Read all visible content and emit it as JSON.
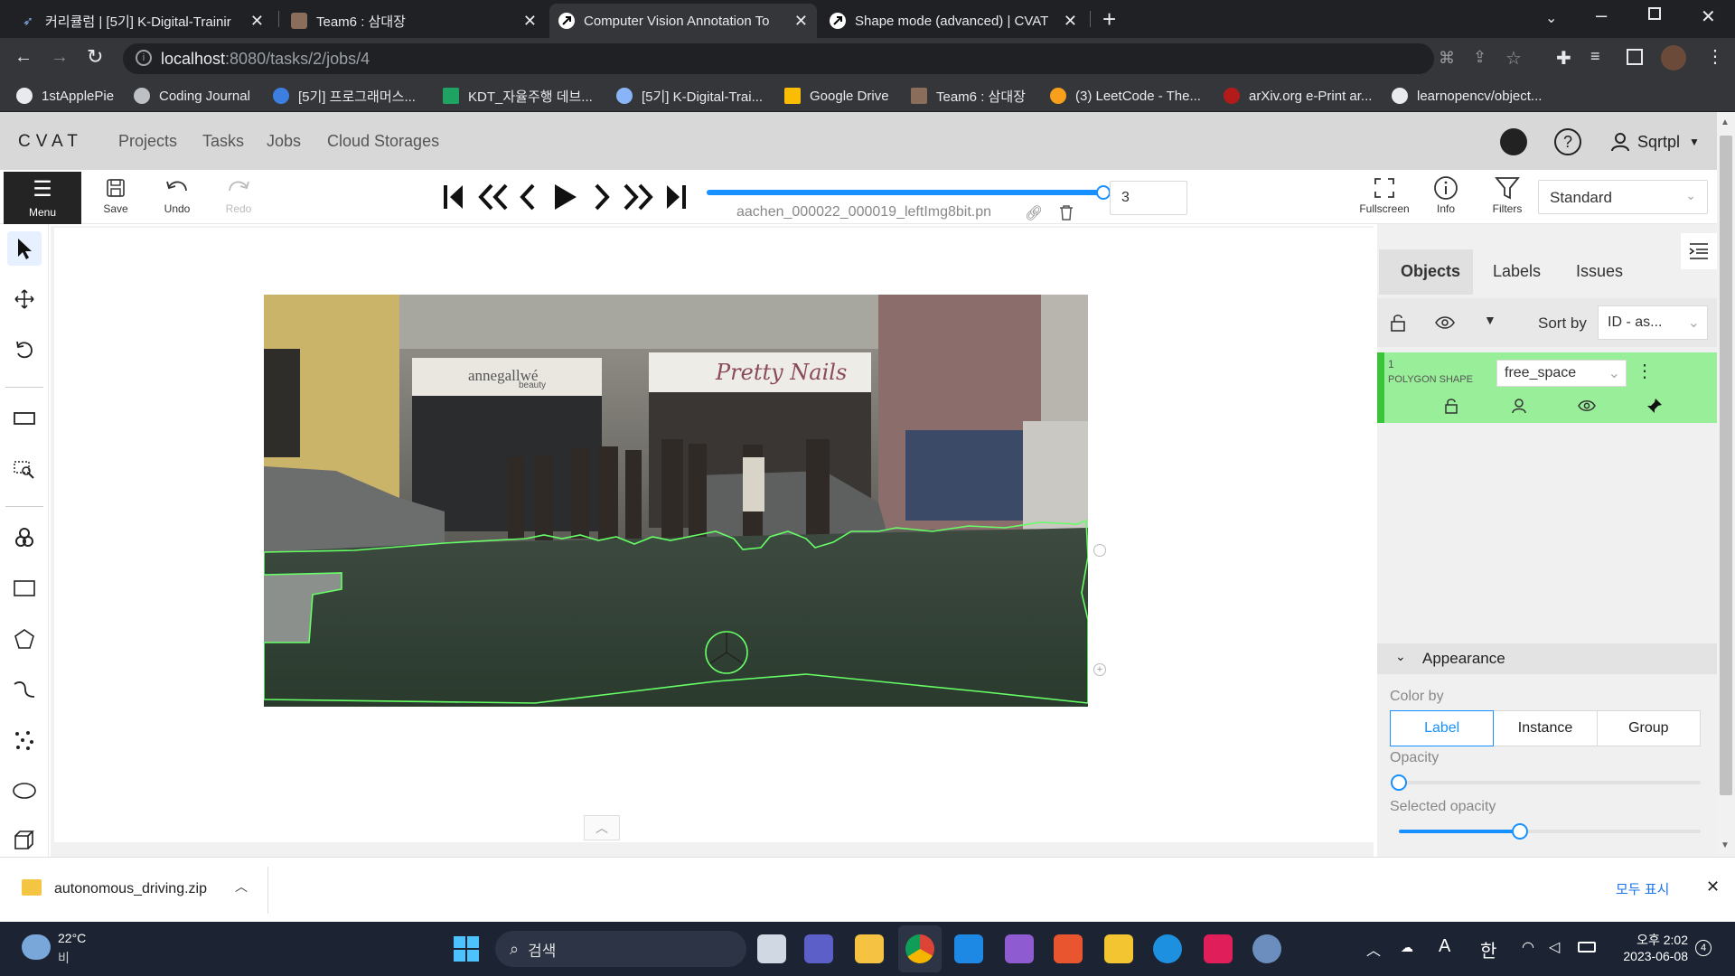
{
  "browser": {
    "tabs": [
      {
        "title": "커리큘럼 | [5기] K-Digital-Trainir",
        "active": false
      },
      {
        "title": "Team6 : 삼대장",
        "active": false
      },
      {
        "title": "Computer Vision Annotation To",
        "active": true
      },
      {
        "title": "Shape mode (advanced) | CVAT",
        "active": false
      }
    ],
    "url_host": "localhost",
    "url_path": ":8080/tasks/2/jobs/4",
    "bookmarks": [
      "1stApplePie",
      "Coding Journal",
      "[5기] 프로그래머스...",
      "KDT_자율주행 데브...",
      "[5기] K-Digital-Trai...",
      "Google Drive",
      "Team6 : 삼대장",
      "(3) LeetCode - The...",
      "arXiv.org e-Print ar...",
      "learnopencv/object..."
    ]
  },
  "cvat": {
    "logo": "CVAT",
    "nav": [
      "Projects",
      "Tasks",
      "Jobs",
      "Cloud Storages"
    ],
    "user": "Sqrtpl",
    "toolbar": {
      "menu": "Menu",
      "save": "Save",
      "undo": "Undo",
      "redo": "Redo",
      "filename": "aachen_000022_000019_leftImg8bit.pn",
      "frame_number": "3",
      "frame_progress": 1.0,
      "fullscreen": "Fullscreen",
      "info": "Info",
      "filters": "Filters",
      "workspace": "Standard"
    },
    "image_text": {
      "shop1": "annegallwé",
      "shop1_sub": "beauty",
      "shop2": "Pretty Nails"
    },
    "sidebar": {
      "tabs": [
        "Objects",
        "Labels",
        "Issues"
      ],
      "active_tab": "Objects",
      "sort_by_label": "Sort by",
      "sort_by_value": "ID - as...",
      "objects": [
        {
          "id": "1",
          "type": "POLYGON SHAPE",
          "label": "free_space",
          "color": "#66ff66"
        }
      ],
      "appearance": {
        "title": "Appearance",
        "color_by_label": "Color by",
        "color_by_options": [
          "Label",
          "Instance",
          "Group"
        ],
        "color_by_selected": "Label",
        "opacity_label": "Opacity",
        "opacity_value": 0.0,
        "selected_opacity_label": "Selected opacity",
        "selected_opacity_value": 0.4
      }
    }
  },
  "download": {
    "file": "autonomous_driving.zip",
    "show_all": "모두 표시"
  },
  "taskbar": {
    "temp": "22°C",
    "weather": "비",
    "search": "검색",
    "ime1": "A",
    "ime2": "한",
    "time": "오후 2:02",
    "date": "2023-06-08",
    "notif": "4"
  },
  "colors": {
    "accent": "#1890ff",
    "polygon": "#66ff66",
    "header_bg": "#d8d8d8",
    "taskbar_bg": "#1c2433"
  }
}
